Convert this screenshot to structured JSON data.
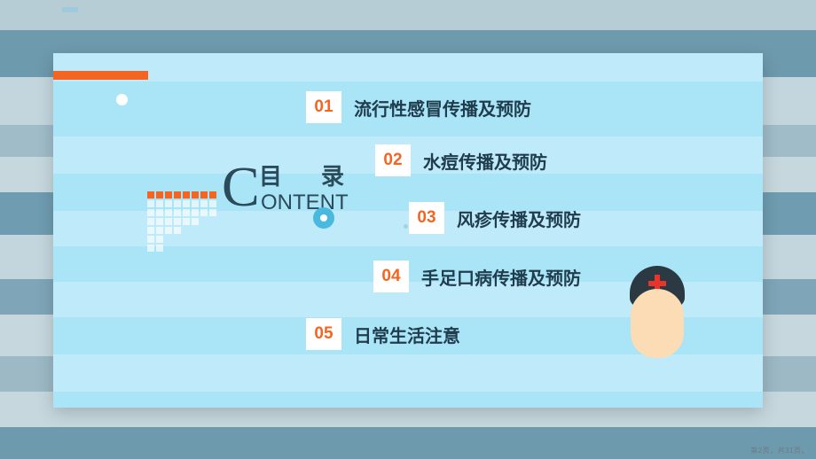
{
  "slide": {
    "title_cn": "目　录",
    "title_en": "ONTENT",
    "title_initial": "C",
    "page_label": "第2页，共31页。",
    "colors": {
      "accent_orange": "#f26522",
      "panel_blue": "#a9e4f7",
      "panel_stripe": "#bfeaf9",
      "text_dark": "#203d4d",
      "cross_red": "#e8342a"
    },
    "items": [
      {
        "num": "01",
        "label": "流行性感冒传播及预防"
      },
      {
        "num": "02",
        "label": "水痘传播及预防"
      },
      {
        "num": "03",
        "label": "风疹传播及预防"
      },
      {
        "num": "04",
        "label": "手足口病传播及预防"
      },
      {
        "num": "05",
        "label": "日常生活注意"
      }
    ]
  }
}
